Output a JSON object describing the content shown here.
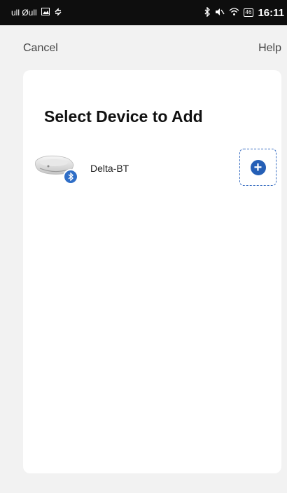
{
  "status_bar": {
    "left_text": "ull Øull",
    "time": "16:11",
    "battery": "46"
  },
  "nav": {
    "cancel_label": "Cancel",
    "help_label": "Help"
  },
  "card": {
    "title": "Select Device to Add",
    "devices": [
      {
        "name": "Delta-BT",
        "badge_icon": "bluetooth-icon",
        "action_icon": "add-circle-icon"
      }
    ]
  },
  "colors": {
    "accent": "#255fb6",
    "status_bar_bg": "#0e0e0e",
    "page_bg": "#f2f2f2"
  }
}
